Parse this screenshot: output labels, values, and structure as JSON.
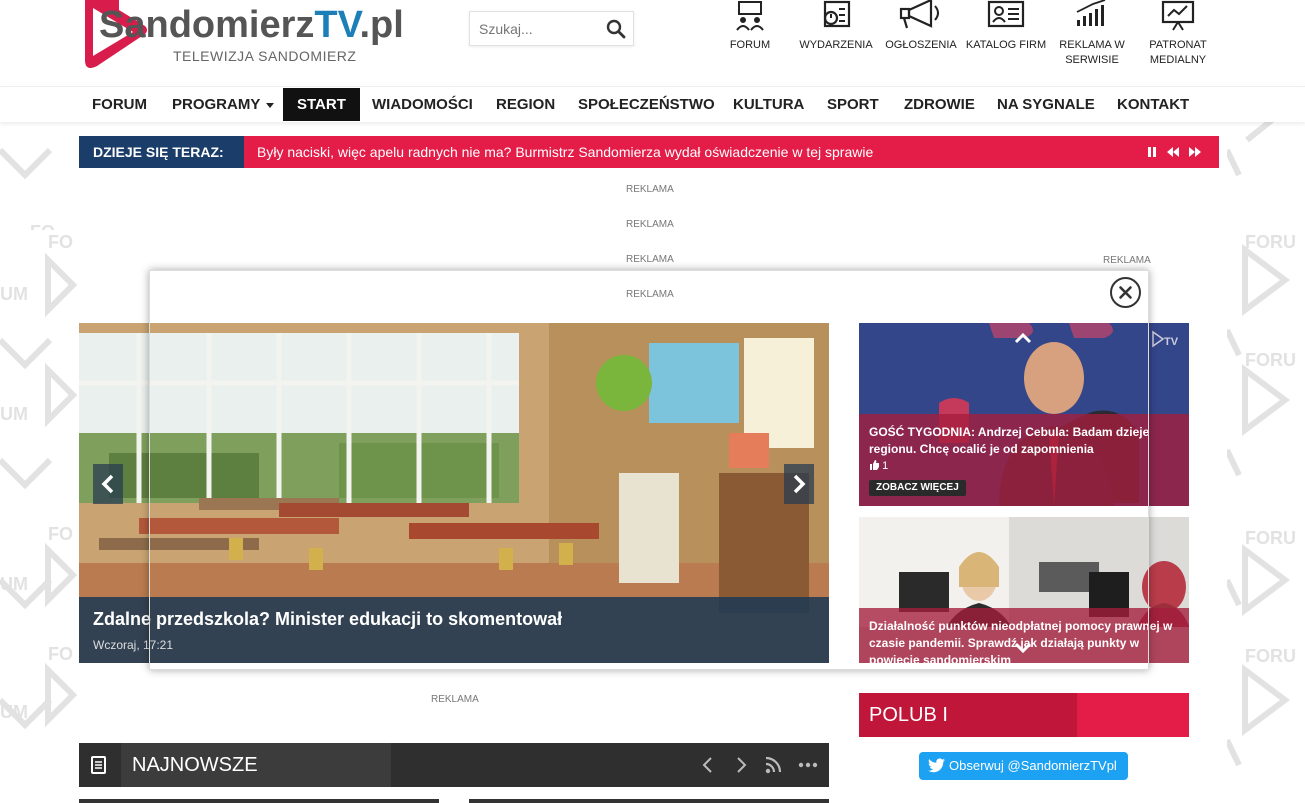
{
  "header": {
    "logo_main": "Sandomierz",
    "logo_tv": "TV",
    "logo_domain": ".pl",
    "logo_sub": "TELEWIZJA SANDOMIERZ",
    "search_placeholder": "Szukaj..."
  },
  "top_icons": [
    {
      "label": "FORUM",
      "icon": "forum-icon"
    },
    {
      "label": "WYDARZENIA",
      "icon": "calendar-icon"
    },
    {
      "label": "OGŁOSZENIA",
      "icon": "megaphone-icon"
    },
    {
      "label": "KATALOG FIRM",
      "icon": "id-card-icon"
    },
    {
      "label": "REKLAMA W SERWISIE",
      "icon": "bar-chart-icon"
    },
    {
      "label": "PATRONAT MEDIALNY",
      "icon": "presentation-icon"
    }
  ],
  "nav": [
    {
      "label": "FORUM"
    },
    {
      "label": "PROGRAMY"
    },
    {
      "label": "START"
    },
    {
      "label": "WIADOMOŚCI"
    },
    {
      "label": "REGION"
    },
    {
      "label": "SPOŁECZEŃSTWO"
    },
    {
      "label": "KULTURA"
    },
    {
      "label": "SPORT"
    },
    {
      "label": "ZDROWIE"
    },
    {
      "label": "NA SYGNALE"
    },
    {
      "label": "KONTAKT"
    }
  ],
  "ticker": {
    "label": "DZIEJE SIĘ TERAZ:",
    "text": "Były naciski, więc apelu radnych nie ma? Burmistrz Sandomierza wydał oświadczenie w tej sprawie"
  },
  "ads": {
    "label": "REKLAMA"
  },
  "slider": {
    "title": "Zdalne przedszkola? Minister edukacji to skomentował",
    "date": "Wczoraj, 17:21"
  },
  "side_cards": [
    {
      "title": "GOŚĆ TYGODNIA: Andrzej Cebula: Badam dzieje regionu. Chcę ocalić je od zapomnienia",
      "likes": "1",
      "more": "ZOBACZ WIĘCEJ"
    },
    {
      "title": "Działalność punktów nieodpłatnej pomocy prawnej w czasie pandemii. Sprawdź jak działają punkty w powiecie sandomierskim"
    }
  ],
  "social": {
    "polub_label": "POLUB I SUBSKRYBUJ",
    "twitter_label": "Obserwuj @SandomierzTVpl"
  },
  "latest": {
    "label": "NAJNOWSZE WIADOMOŚCI"
  },
  "colors": {
    "accent_red": "#e31c48",
    "navy": "#1b3d6a",
    "twitter": "#1da1f2"
  }
}
